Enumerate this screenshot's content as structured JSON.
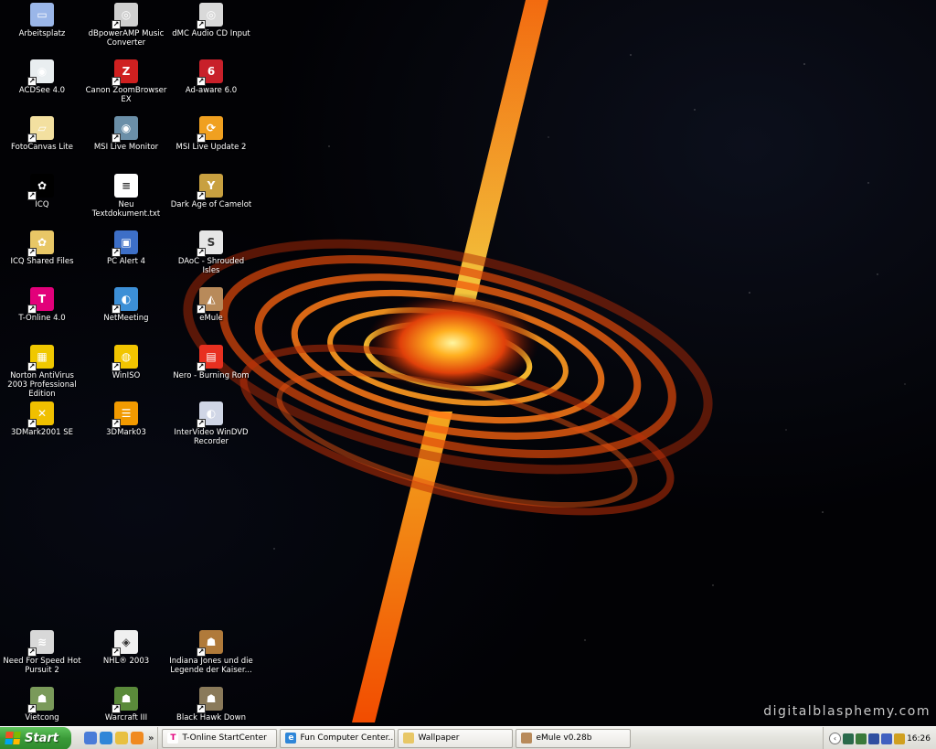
{
  "desktop": {
    "watermark": "digitalblasphemy.com",
    "icons": [
      {
        "id": "arbeitsplatz",
        "label": "Arbeitsplatz",
        "icon": "computer-icon",
        "color": "#9ab6e8",
        "glyph": "▭"
      },
      {
        "id": "acdsee",
        "label": "ACDSee 4.0",
        "icon": "eye-icon",
        "color": "#e9eef0",
        "glyph": "◉"
      },
      {
        "id": "fotocanvas",
        "label": "FotoCanvas Lite",
        "icon": "canvas-icon",
        "color": "#f3e0a0",
        "glyph": "▱"
      },
      {
        "id": "icq",
        "label": "ICQ",
        "icon": "flower-icon",
        "color": "#000000",
        "glyph": "✿"
      },
      {
        "id": "icq-shared",
        "label": "ICQ Shared Files",
        "icon": "folder-icon",
        "color": "#e8c766",
        "glyph": "✿"
      },
      {
        "id": "t-online",
        "label": "T-Online 4.0",
        "icon": "t-online-icon",
        "color": "#e2007a",
        "glyph": "T"
      },
      {
        "id": "norton",
        "label": "Norton AntiVirus 2003 Professional Edition",
        "icon": "norton-icon",
        "color": "#f0c800",
        "glyph": "▦"
      },
      {
        "id": "3dmark2001",
        "label": "3DMark2001 SE",
        "icon": "3dmark-icon",
        "color": "#f0c000",
        "glyph": "✕"
      },
      {
        "id": "dbpoweramp",
        "label": "dBpowerAMP Music Converter",
        "icon": "speaker-icon",
        "color": "#cfcfcf",
        "glyph": "◎"
      },
      {
        "id": "canon-zoombrowser",
        "label": "Canon ZoomBrowser EX",
        "icon": "canon-icon",
        "color": "#cf2020",
        "glyph": "Z"
      },
      {
        "id": "msi-live-monitor",
        "label": "MSI Live Monitor",
        "icon": "monitor-eye-icon",
        "color": "#6b8fa8",
        "glyph": "◉"
      },
      {
        "id": "neu-textdokument",
        "label": "Neu Textdokument.txt",
        "icon": "text-file-icon",
        "color": "#ffffff",
        "glyph": "≡"
      },
      {
        "id": "pc-alert",
        "label": "PC Alert 4",
        "icon": "pc-alert-icon",
        "color": "#3d6fc7",
        "glyph": "▣"
      },
      {
        "id": "netmeeting",
        "label": "NetMeeting",
        "icon": "globe-icon",
        "color": "#3c8fd6",
        "glyph": "◐"
      },
      {
        "id": "winiso",
        "label": "WinISO",
        "icon": "winiso-icon",
        "color": "#f2c500",
        "glyph": "◍"
      },
      {
        "id": "3dmark03",
        "label": "3DMark03",
        "icon": "3dmark03-icon",
        "color": "#f29a00",
        "glyph": "☰"
      },
      {
        "id": "dmc-audio",
        "label": "dMC Audio CD Input",
        "icon": "cd-icon",
        "color": "#d9d9d9",
        "glyph": "◎"
      },
      {
        "id": "ad-aware",
        "label": "Ad-aware 6.0",
        "icon": "ad-aware-icon",
        "color": "#c8202a",
        "glyph": "6"
      },
      {
        "id": "msi-live-update",
        "label": "MSI Live Update 2",
        "icon": "live-update-icon",
        "color": "#f0a020",
        "glyph": "⟳"
      },
      {
        "id": "dark-age",
        "label": "Dark Age of Camelot",
        "icon": "grail-icon",
        "color": "#c8a040",
        "glyph": "Y"
      },
      {
        "id": "daoc-si",
        "label": "DAoC - Shrouded Isles",
        "icon": "daoc-icon",
        "color": "#e6e6e6",
        "glyph": "S"
      },
      {
        "id": "emule",
        "label": "eMule",
        "icon": "mule-icon",
        "color": "#b88a5a",
        "glyph": "◭"
      },
      {
        "id": "nero",
        "label": "Nero - Burning Rom",
        "icon": "nero-icon",
        "color": "#e83020",
        "glyph": "▤"
      },
      {
        "id": "windvd",
        "label": "InterVideo WinDVD Recorder",
        "icon": "dvd-icon",
        "color": "#d0d6e6",
        "glyph": "◐"
      },
      {
        "id": "nfs",
        "label": "Need For Speed Hot Pursuit 2",
        "icon": "nfs-icon",
        "color": "#d8d8d8",
        "glyph": "≋"
      },
      {
        "id": "nhl",
        "label": "NHL® 2003",
        "icon": "nhl-icon",
        "color": "#f0f0f0",
        "glyph": "◈"
      },
      {
        "id": "indiana",
        "label": "Indiana Jones und die Legende der Kaiser...",
        "icon": "indiana-icon",
        "color": "#b07a3a",
        "glyph": "☗"
      },
      {
        "id": "vietcong",
        "label": "Vietcong",
        "icon": "vietcong-icon",
        "color": "#7a9a5a",
        "glyph": "☗"
      },
      {
        "id": "warcraft",
        "label": "Warcraft III",
        "icon": "warcraft-icon",
        "color": "#5a8a3a",
        "glyph": "☗"
      },
      {
        "id": "black-hawk",
        "label": "Black Hawk Down",
        "icon": "soldier-icon",
        "color": "#8a7a5a",
        "glyph": "☗"
      }
    ]
  },
  "taskbar": {
    "start_label": "Start",
    "quick_launch": [
      {
        "icon": "desktop-icon",
        "color": "#4a7cd8"
      },
      {
        "icon": "ie-icon",
        "color": "#2f86d8"
      },
      {
        "icon": "outlook-icon",
        "color": "#e8c040"
      },
      {
        "icon": "media-player-icon",
        "color": "#f08a20"
      }
    ],
    "quick_launch_more": "»",
    "tasks": [
      {
        "label": "T-Online StartCenter",
        "icon": "t-online-icon",
        "glyph": "T",
        "color": "#ffffff"
      },
      {
        "label": "Fun Computer Center...",
        "icon": "ie-icon",
        "glyph": "e",
        "color": "#2f86d8"
      },
      {
        "label": "Wallpaper",
        "icon": "folder-icon",
        "glyph": "",
        "color": "#e8c766"
      },
      {
        "label": "eMule v0.28b",
        "icon": "mule-icon",
        "glyph": "",
        "color": "#b88a5a"
      }
    ],
    "tray": {
      "chevron": "‹",
      "icons": [
        {
          "icon": "eye-tray-icon",
          "color": "#2a6a4a"
        },
        {
          "icon": "network-tray-icon",
          "color": "#3a7a3a"
        },
        {
          "icon": "monitor-tray-icon",
          "color": "#304fa0"
        },
        {
          "icon": "display-tray-icon",
          "color": "#4060c0"
        },
        {
          "icon": "volume-tray-icon",
          "color": "#d0a020"
        }
      ],
      "clock": "16:26"
    }
  }
}
